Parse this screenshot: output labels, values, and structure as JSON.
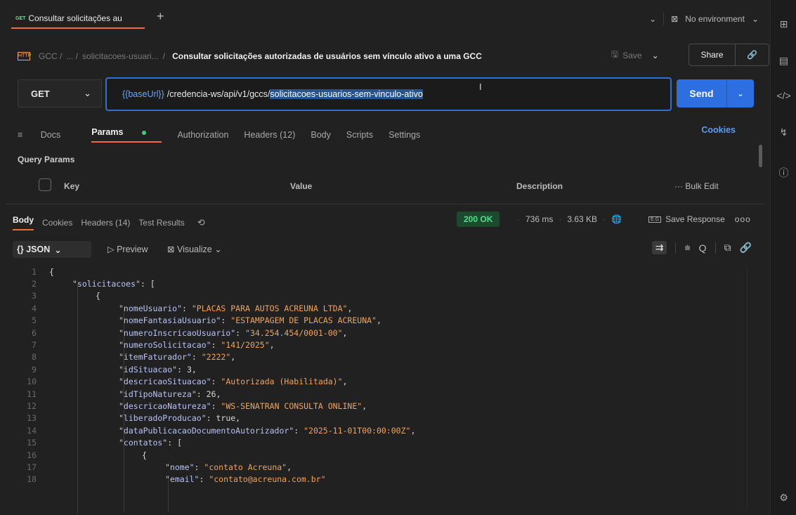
{
  "tab": {
    "method": "GET",
    "title": "Consultar solicitações au",
    "new_tab": "+"
  },
  "environment": {
    "label": "No environment"
  },
  "breadcrumb": {
    "root": "GCC /",
    "ellipsis": "... /",
    "folder": "solicitacoes-usuari...",
    "sep": "/",
    "title": "Consultar solicitações autorizadas de usuários sem vínculo ativo a uma GCC"
  },
  "actions": {
    "save": "Save",
    "share": "Share"
  },
  "request": {
    "method": "GET",
    "url_var": "{{baseUrl}}",
    "url_path": "/credencia-ws/api/v1/gccs/",
    "url_selected": "solicitacoes-usuarios-sem-vinculo-ativo",
    "send": "Send"
  },
  "request_tabs": {
    "docs": "Docs",
    "params": "Params",
    "authorization": "Authorization",
    "headers": "Headers (12)",
    "body": "Body",
    "scripts": "Scripts",
    "settings": "Settings",
    "cookies": "Cookies"
  },
  "query_params": {
    "title": "Query Params",
    "key": "Key",
    "value": "Value",
    "description": "Description",
    "bulk_edit": "Bulk Edit"
  },
  "response_tabs": {
    "body": "Body",
    "cookies": "Cookies",
    "headers": "Headers (14)",
    "test_results": "Test Results",
    "status": "200 OK",
    "time": "736 ms",
    "size": "3.63 KB",
    "save_response": "Save Response"
  },
  "response_toolbar": {
    "format": "{} JSON",
    "preview": "Preview",
    "visualize": "Visualize"
  },
  "code_lines": [
    {
      "n": "1",
      "i": 0,
      "t": [
        [
          "p",
          "{"
        ]
      ]
    },
    {
      "n": "2",
      "i": 1,
      "t": [
        [
          "k",
          "\"solicitacoes\""
        ],
        [
          "p",
          ": ["
        ]
      ]
    },
    {
      "n": "3",
      "i": 2,
      "t": [
        [
          "p",
          "{"
        ]
      ]
    },
    {
      "n": "4",
      "i": 3,
      "t": [
        [
          "k",
          "\"nomeUsuario\""
        ],
        [
          "p",
          ": "
        ],
        [
          "s",
          "\"PLACAS PARA AUTOS ACREUNA LTDA\""
        ],
        [
          "p",
          ","
        ]
      ]
    },
    {
      "n": "5",
      "i": 3,
      "t": [
        [
          "k",
          "\"nomeFantasiaUsuario\""
        ],
        [
          "p",
          ": "
        ],
        [
          "s",
          "\"ESTAMPAGEM DE PLACAS ACREUNA\""
        ],
        [
          "p",
          ","
        ]
      ]
    },
    {
      "n": "6",
      "i": 3,
      "t": [
        [
          "k",
          "\"numeroInscricaoUsuario\""
        ],
        [
          "p",
          ": "
        ],
        [
          "s",
          "\"34.254.454/0001-00\""
        ],
        [
          "p",
          ","
        ]
      ]
    },
    {
      "n": "7",
      "i": 3,
      "t": [
        [
          "k",
          "\"numeroSolicitacao\""
        ],
        [
          "p",
          ": "
        ],
        [
          "s",
          "\"141/2025\""
        ],
        [
          "p",
          ","
        ]
      ]
    },
    {
      "n": "8",
      "i": 3,
      "t": [
        [
          "k",
          "\"itemFaturador\""
        ],
        [
          "p",
          ": "
        ],
        [
          "s",
          "\"2222\""
        ],
        [
          "p",
          ","
        ]
      ]
    },
    {
      "n": "9",
      "i": 3,
      "t": [
        [
          "k",
          "\"idSituacao\""
        ],
        [
          "p",
          ": 3,"
        ]
      ]
    },
    {
      "n": "10",
      "i": 3,
      "t": [
        [
          "k",
          "\"descricaoSituacao\""
        ],
        [
          "p",
          ": "
        ],
        [
          "s",
          "\"Autorizada (Habilitada)\""
        ],
        [
          "p",
          ","
        ]
      ]
    },
    {
      "n": "11",
      "i": 3,
      "t": [
        [
          "k",
          "\"idTipoNatureza\""
        ],
        [
          "p",
          ": 26,"
        ]
      ]
    },
    {
      "n": "12",
      "i": 3,
      "t": [
        [
          "k",
          "\"descricaoNatureza\""
        ],
        [
          "p",
          ": "
        ],
        [
          "s",
          "\"WS-SENATRAN CONSULTA ONLINE\""
        ],
        [
          "p",
          ","
        ]
      ]
    },
    {
      "n": "13",
      "i": 3,
      "t": [
        [
          "k",
          "\"liberadoProducao\""
        ],
        [
          "p",
          ": true,"
        ]
      ]
    },
    {
      "n": "14",
      "i": 3,
      "t": [
        [
          "k",
          "\"dataPublicacaoDocumentoAutorizador\""
        ],
        [
          "p",
          ": "
        ],
        [
          "s",
          "\"2025-11-01T00:00:00Z\""
        ],
        [
          "p",
          ","
        ]
      ]
    },
    {
      "n": "15",
      "i": 3,
      "t": [
        [
          "k",
          "\"contatos\""
        ],
        [
          "p",
          ": ["
        ]
      ]
    },
    {
      "n": "16",
      "i": 4,
      "t": [
        [
          "p",
          "{"
        ]
      ]
    },
    {
      "n": "17",
      "i": 5,
      "t": [
        [
          "k",
          "\"nome\""
        ],
        [
          "p",
          ": "
        ],
        [
          "s",
          "\"contato Acreuna\""
        ],
        [
          "p",
          ","
        ]
      ]
    },
    {
      "n": "18",
      "i": 5,
      "t": [
        [
          "k",
          "\"email\""
        ],
        [
          "p",
          ": "
        ],
        [
          "s",
          "\"contato@acreuna.com.br\""
        ]
      ]
    }
  ],
  "colors": {
    "accent": "#f26b3a",
    "send": "#2d6fe0",
    "status_ok": "#4ee08b",
    "json_key": "#b9c3f5",
    "json_string": "#f0a35a"
  }
}
